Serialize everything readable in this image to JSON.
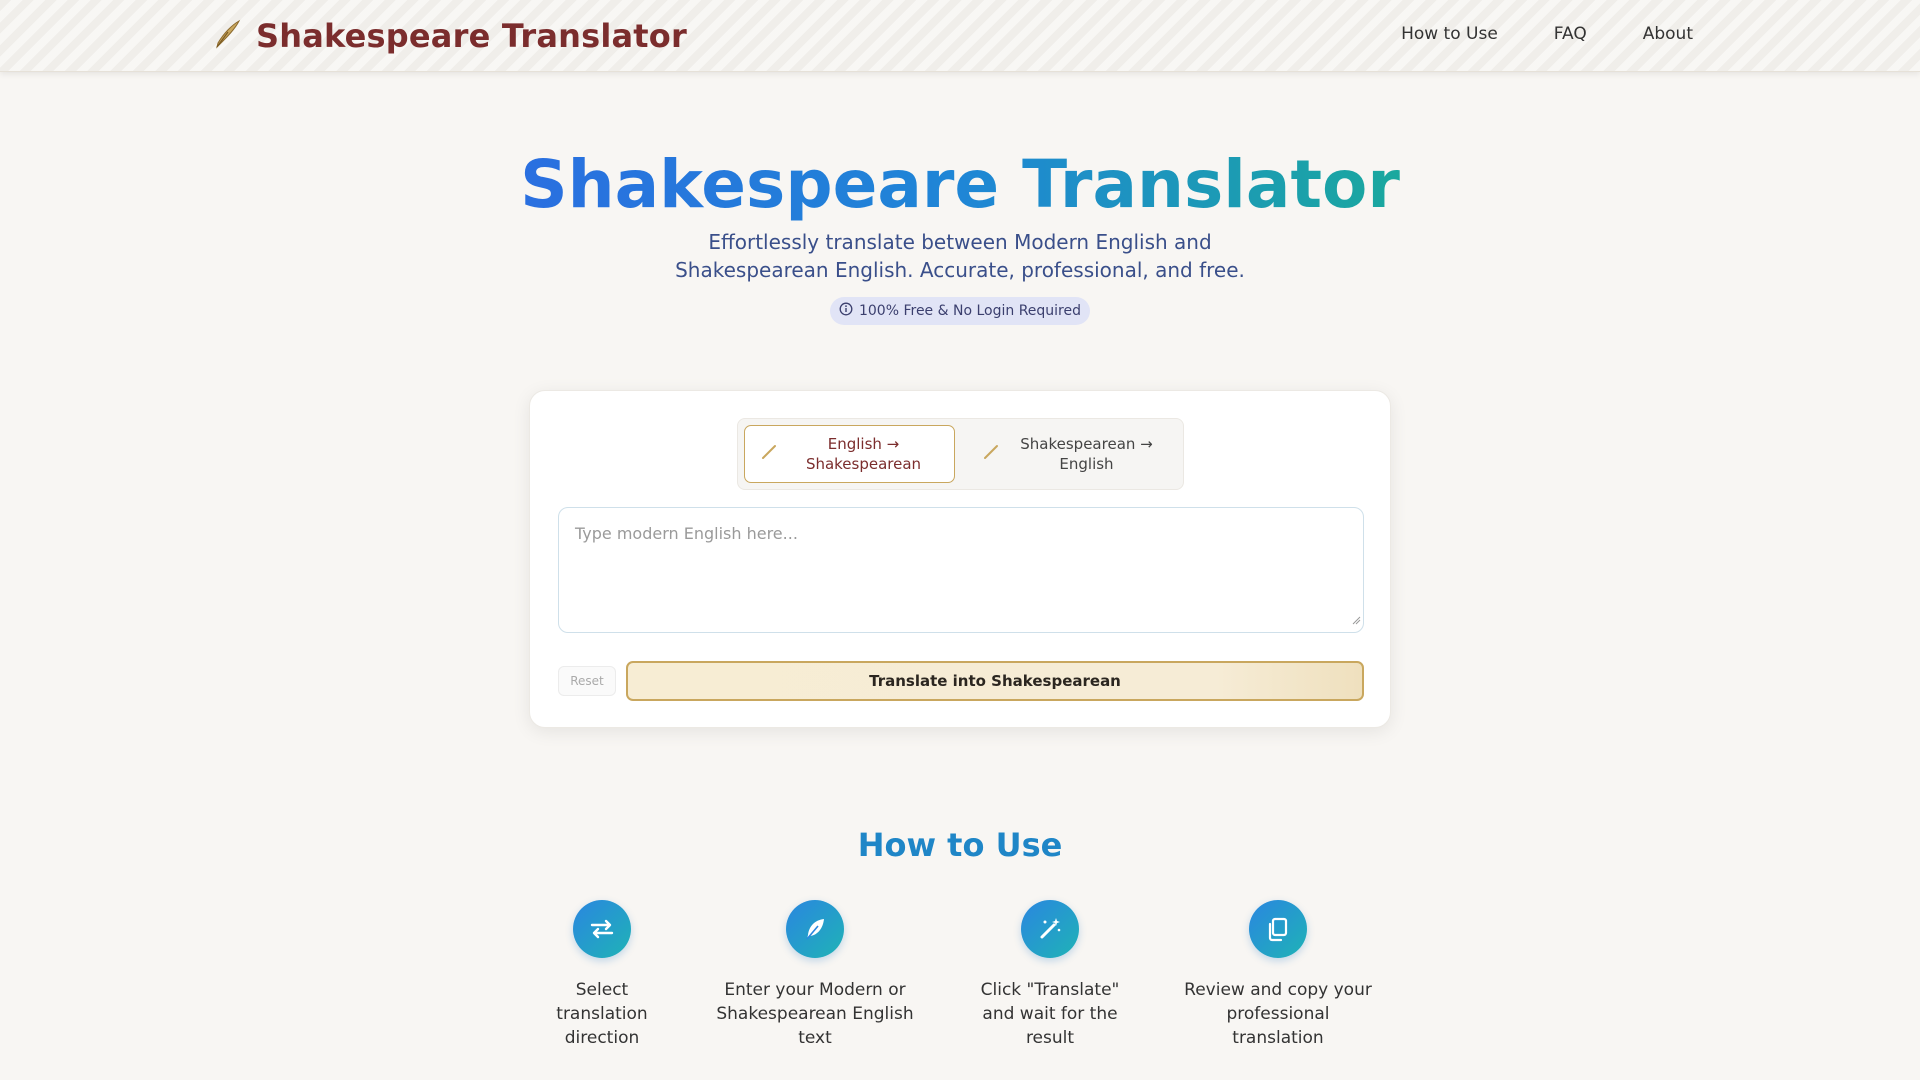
{
  "header": {
    "brand": "Shakespeare Translator",
    "nav": [
      {
        "label": "How to Use"
      },
      {
        "label": "FAQ"
      },
      {
        "label": "About"
      }
    ]
  },
  "hero": {
    "title": "Shakespeare Translator",
    "subtitle": "Effortlessly translate between Modern English and Shakespearean English. Accurate, professional, and free.",
    "badge": "100% Free & No Login Required"
  },
  "translator": {
    "modes": [
      {
        "label": "English → Shakespearean",
        "active": true
      },
      {
        "label": "Shakespearean → English",
        "active": false
      }
    ],
    "input": {
      "value": "",
      "placeholder": "Type modern English here..."
    },
    "reset_label": "Reset",
    "translate_label": "Translate into Shakespearean"
  },
  "how_to_use": {
    "title": "How to Use",
    "steps": [
      {
        "icon": "swap-arrows-icon",
        "text": "Select translation direction"
      },
      {
        "icon": "feather-icon",
        "text": "Enter your Modern or Shakespearean English text"
      },
      {
        "icon": "magic-wand-icon",
        "text": "Click \"Translate\" and wait for the result"
      },
      {
        "icon": "copy-icon",
        "text": "Review and copy your professional translation"
      }
    ]
  },
  "colors": {
    "brand": "#7b2d2d",
    "accent_gold": "#c9a75e",
    "accent_blue": "#1f86c7",
    "accent_teal": "#1aa89e"
  }
}
